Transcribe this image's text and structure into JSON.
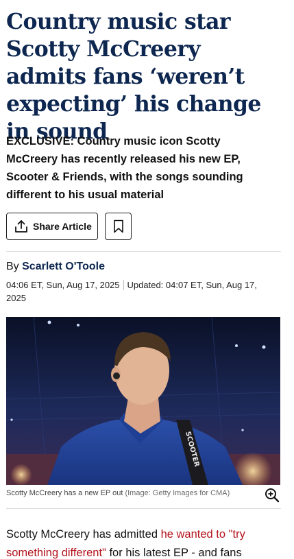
{
  "article": {
    "headline": "Country music star Scotty McCreery admits fans ‘weren’t expecting’ his change in sound",
    "standfirst": "EXCLUSIVE: Country music icon Scotty McCreery has recently released his new EP, Scooter & Friends, with the songs sounding different to his usual material",
    "share_label": "Share Article",
    "byline_prefix": "By",
    "author": "Scarlett O'Toole",
    "published": "04:06 ET, Sun, Aug 17, 2025",
    "updated": "Updated: 04:07 ET, Sun, Aug 17, 2025",
    "image_caption": "Scotty McCreery has a new EP out",
    "image_credit": "(Image: Getty Images for CMA)",
    "image_strap_text": "SCOOTER",
    "body_before_link": "Scotty McCreery has admitted ",
    "body_link": "he wanted to \"try something different\"",
    "body_after_link": " for his latest EP - and fans"
  },
  "icons": {
    "share": "share-upload-icon",
    "bookmark": "bookmark-icon",
    "zoom": "zoom-in-icon"
  },
  "colors": {
    "headline": "#0e2750",
    "author": "#0e2750",
    "link": "#b3121b"
  }
}
